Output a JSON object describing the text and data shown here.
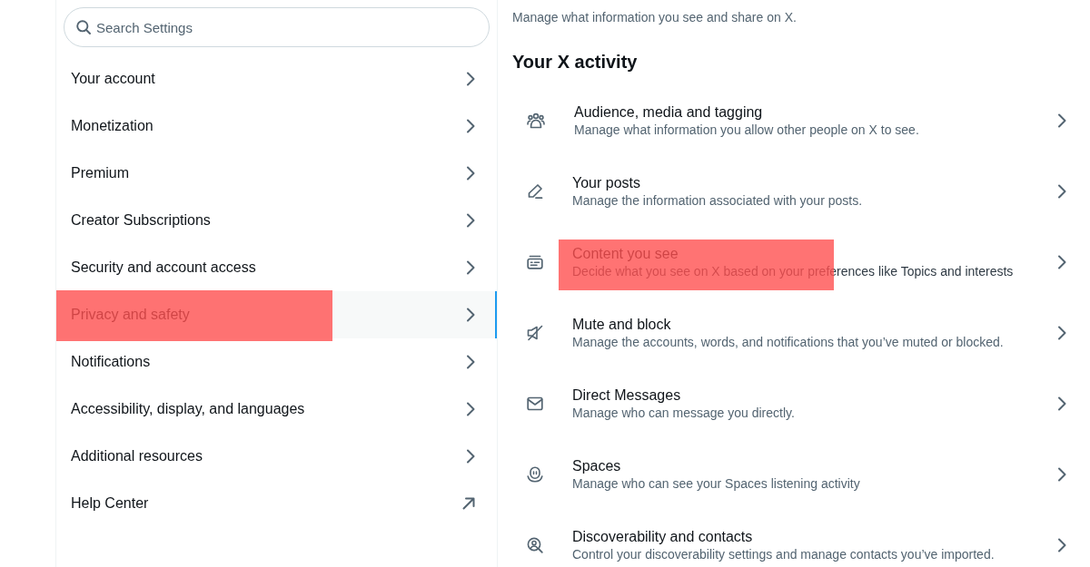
{
  "search": {
    "placeholder": "Search Settings"
  },
  "sidebar": {
    "items": [
      {
        "label": "Your account",
        "kind": "section",
        "selected": false,
        "highlighted": false
      },
      {
        "label": "Monetization",
        "kind": "section",
        "selected": false,
        "highlighted": false
      },
      {
        "label": "Premium",
        "kind": "section",
        "selected": false,
        "highlighted": false
      },
      {
        "label": "Creator Subscriptions",
        "kind": "section",
        "selected": false,
        "highlighted": false
      },
      {
        "label": "Security and account access",
        "kind": "section",
        "selected": false,
        "highlighted": false
      },
      {
        "label": "Privacy and safety",
        "kind": "section",
        "selected": true,
        "highlighted": true
      },
      {
        "label": "Notifications",
        "kind": "section",
        "selected": false,
        "highlighted": false
      },
      {
        "label": "Accessibility, display, and languages",
        "kind": "section",
        "selected": false,
        "highlighted": false
      },
      {
        "label": "Additional resources",
        "kind": "section",
        "selected": false,
        "highlighted": false
      },
      {
        "label": "Help Center",
        "kind": "external",
        "selected": false,
        "highlighted": false
      }
    ]
  },
  "main": {
    "intro": "Manage what information you see and share on X.",
    "heading": "Your X activity",
    "items": [
      {
        "title": "Audience, media and tagging",
        "description": "Manage what information you allow other people on X to see.",
        "highlighted": false
      },
      {
        "title": "Your posts",
        "description": "Manage the information associated with your posts.",
        "highlighted": false
      },
      {
        "title": "Content you see",
        "description": "Decide what you see on X based on your preferences like Topics and interests",
        "highlighted": true
      },
      {
        "title": "Mute and block",
        "description": "Manage the accounts, words, and notifications that you’ve muted or blocked.",
        "highlighted": false
      },
      {
        "title": "Direct Messages",
        "description": "Manage who can message you directly.",
        "highlighted": false
      },
      {
        "title": "Spaces",
        "description": "Manage who can see your Spaces listening activity",
        "highlighted": false
      },
      {
        "title": "Discoverability and contacts",
        "description": "Control your discoverability settings and manage contacts you’ve imported.",
        "highlighted": false
      }
    ]
  }
}
